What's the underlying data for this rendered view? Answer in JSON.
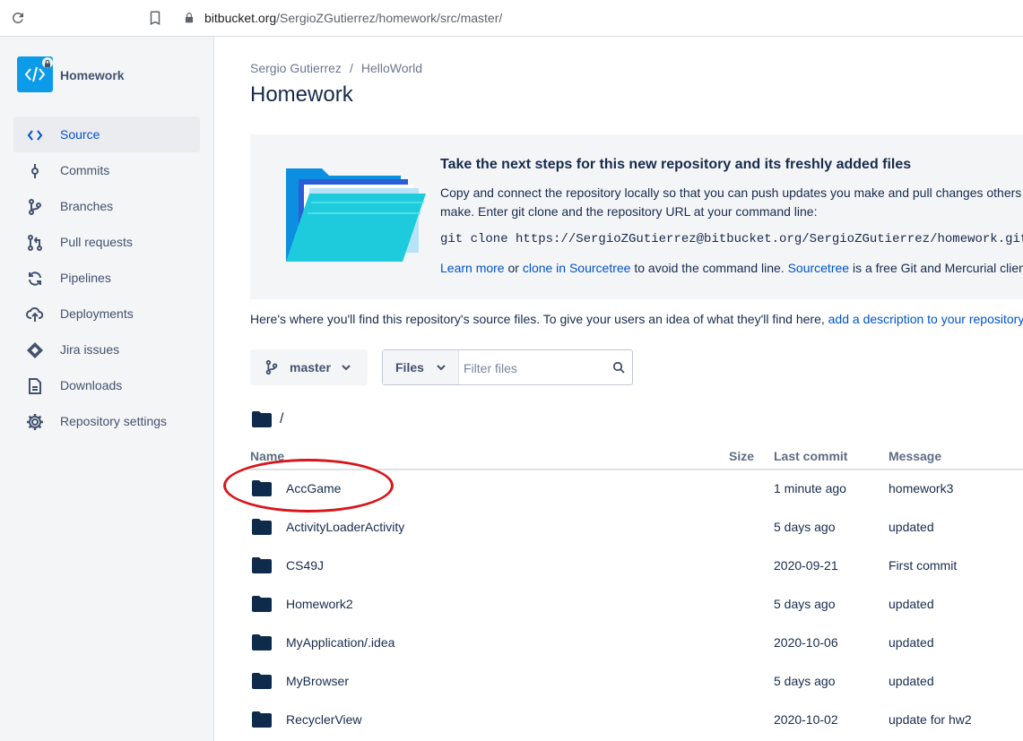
{
  "browser": {
    "url_host": "bitbucket.org",
    "url_path": "/SergioZGutierrez/homework/src/master/"
  },
  "sidebar": {
    "repo_name": "Homework",
    "items": [
      {
        "label": "Source",
        "icon": "code-icon",
        "active": true
      },
      {
        "label": "Commits",
        "icon": "commit-icon"
      },
      {
        "label": "Branches",
        "icon": "branch-icon"
      },
      {
        "label": "Pull requests",
        "icon": "pull-request-icon"
      },
      {
        "label": "Pipelines",
        "icon": "pipelines-icon"
      },
      {
        "label": "Deployments",
        "icon": "cloud-upload-icon"
      },
      {
        "label": "Jira issues",
        "icon": "jira-icon"
      },
      {
        "label": "Downloads",
        "icon": "document-icon"
      },
      {
        "label": "Repository settings",
        "icon": "gear-icon"
      }
    ]
  },
  "breadcrumb": {
    "owner": "Sergio Gutierrez",
    "separator": "/",
    "project": "HelloWorld"
  },
  "page_title": "Homework",
  "banner": {
    "title": "Take the next steps for this new repository and its freshly added files",
    "body": "Copy and connect the repository locally so that you can push updates you make and pull changes others make. Enter git clone and the repository URL at your command line:",
    "command": "git clone https://SergioZGutierrez@bitbucket.org/SergioZGutierrez/homework.git",
    "learn_more": "Learn more",
    "or": " or ",
    "clone_sourcetree": "clone in Sourcetree",
    "avoid": " to avoid the command line. ",
    "sourcetree": "Sourcetree",
    "free": " is a free Git and Mercurial client"
  },
  "description": {
    "text": "Here's where you'll find this repository's source files. To give your users an idea of what they'll find here, ",
    "link": "add a description to your repository"
  },
  "toolbar": {
    "branch": "master",
    "files_label": "Files",
    "filter_placeholder": "Filter files"
  },
  "path": "/",
  "table": {
    "headers": {
      "name": "Name",
      "size": "Size",
      "last_commit": "Last commit",
      "message": "Message"
    },
    "rows": [
      {
        "name": "AccGame",
        "last_commit": "1 minute ago",
        "message": "homework3"
      },
      {
        "name": "ActivityLoaderActivity",
        "last_commit": "5 days ago",
        "message": "updated"
      },
      {
        "name": "CS49J",
        "last_commit": "2020-09-21",
        "message": "First commit"
      },
      {
        "name": "Homework2",
        "last_commit": "5 days ago",
        "message": "updated"
      },
      {
        "name": "MyApplication/.idea",
        "last_commit": "2020-10-06",
        "message": "updated"
      },
      {
        "name": "MyBrowser",
        "last_commit": "5 days ago",
        "message": "updated"
      },
      {
        "name": "RecyclerView",
        "last_commit": "2020-10-02",
        "message": "update for hw2"
      }
    ]
  },
  "colors": {
    "accent": "#0052cc",
    "annotation": "#d8151b",
    "folder": "#0f2b4b"
  }
}
